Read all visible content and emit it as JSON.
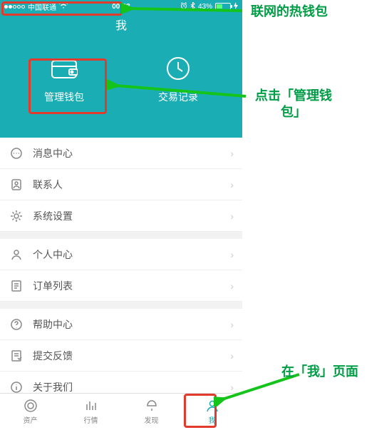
{
  "status": {
    "carrier": "中国联通",
    "time": "00:23",
    "battery": "43%"
  },
  "header": {
    "title": "我",
    "wallet": "管理钱包",
    "history": "交易记录"
  },
  "rows": {
    "msg": "消息中心",
    "contacts": "联系人",
    "settings": "系统设置",
    "personal": "个人中心",
    "orders": "订单列表",
    "help": "帮助中心",
    "feedback": "提交反馈",
    "about": "关于我们"
  },
  "tabs": {
    "assets": "资产",
    "market": "行情",
    "discover": "发现",
    "me": "我"
  },
  "annotations": {
    "top": "联网的热钱包",
    "wallet": "点击「管理钱\n包」",
    "me": "在「我」页面"
  }
}
